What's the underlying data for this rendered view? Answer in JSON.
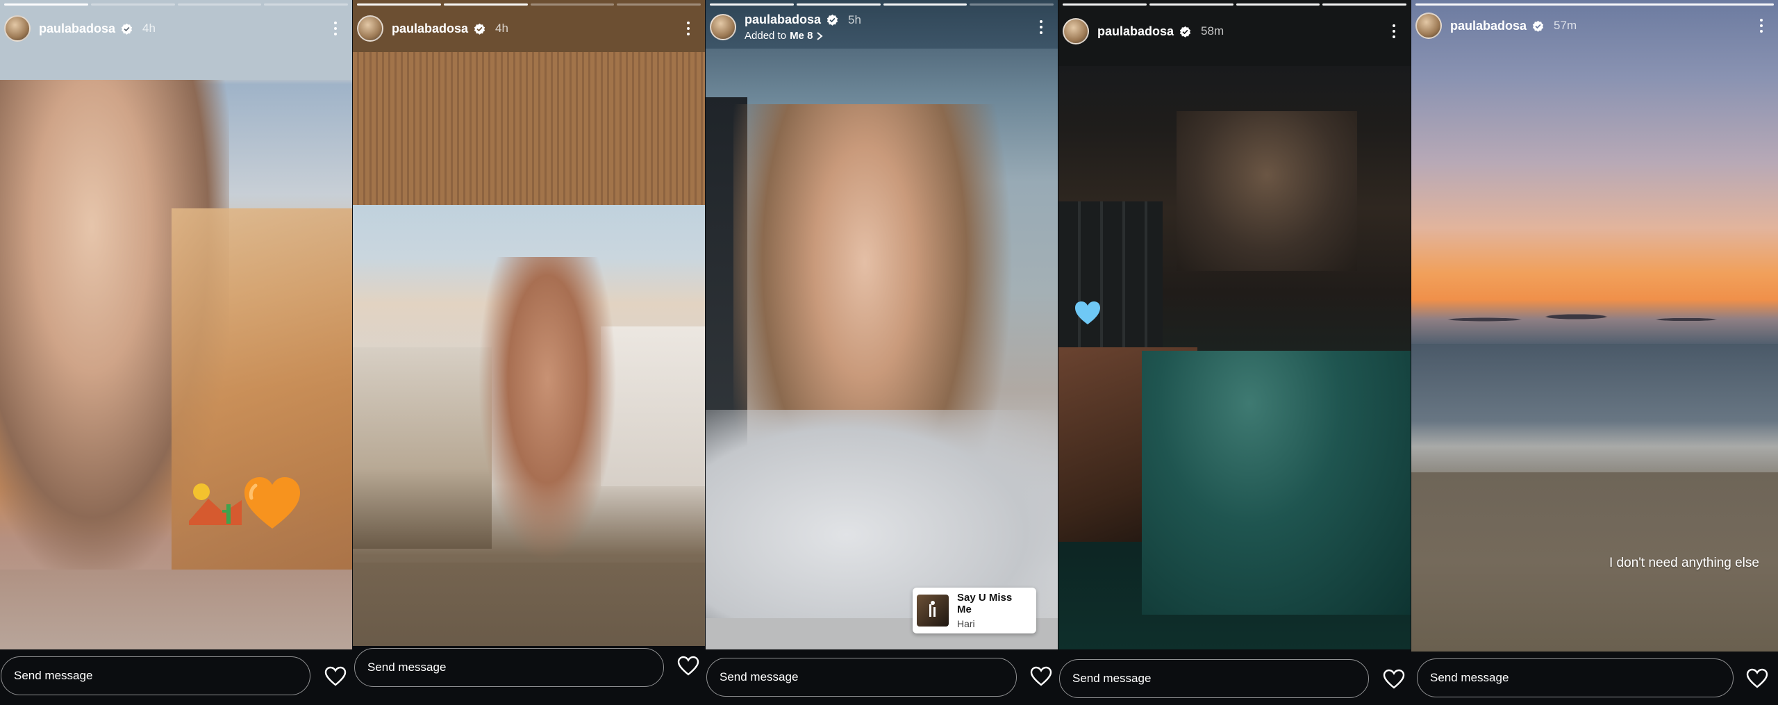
{
  "stories": [
    {
      "username": "paulabadosa",
      "time": "4h",
      "added_to": null,
      "send_placeholder": "Send message",
      "overlay_text": null,
      "stickers": [
        "desert-emoji",
        "orange-heart-emoji"
      ],
      "music": null,
      "progress_done": 1
    },
    {
      "username": "paulabadosa",
      "time": "4h",
      "added_to": null,
      "send_placeholder": "Send message",
      "overlay_text": null,
      "stickers": [],
      "music": null,
      "progress_done": 2
    },
    {
      "username": "paulabadosa",
      "time": "5h",
      "added_to": {
        "prefix": "Added to",
        "highlight": "Me 8"
      },
      "send_placeholder": "Send message",
      "overlay_text": null,
      "stickers": [],
      "music": {
        "title": "Say U Miss Me",
        "artist": "Hari"
      },
      "progress_done": 3
    },
    {
      "username": "paulabadosa",
      "time": "58m",
      "added_to": null,
      "send_placeholder": "Send message",
      "overlay_text": null,
      "stickers": [
        "light-blue-heart-emoji"
      ],
      "music": null,
      "progress_done": 4
    },
    {
      "username": "paulabadosa",
      "time": "57m",
      "added_to": null,
      "send_placeholder": "Send message",
      "overlay_text": "I don't need anything else",
      "stickers": [],
      "music": null,
      "progress_done": 5
    }
  ],
  "colors": {
    "background": "#0b0d10",
    "verified_blue": "#ffffff",
    "orange_heart": "#f7931e",
    "blue_heart": "#6fc8f5"
  }
}
